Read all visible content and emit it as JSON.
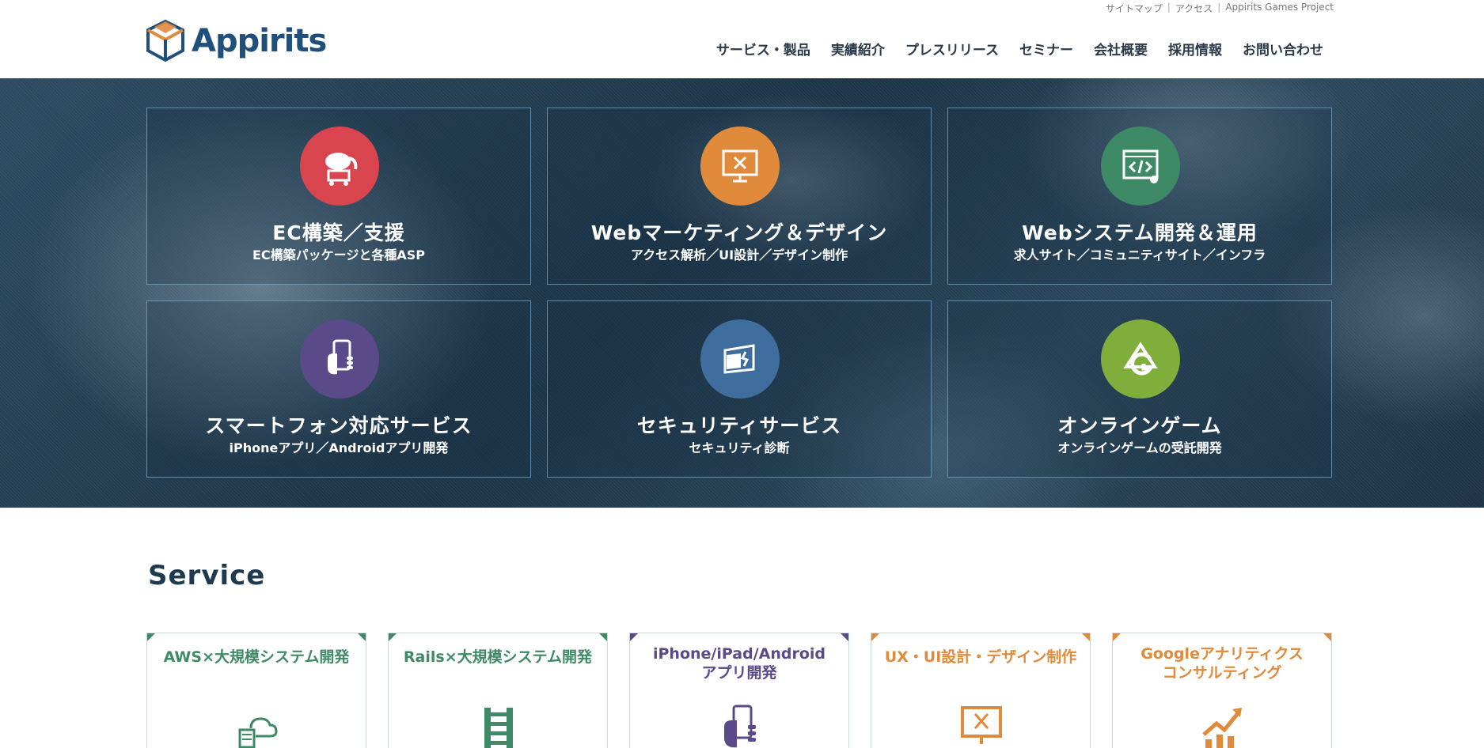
{
  "header": {
    "logo_text": "Appirits",
    "util_links": [
      "サイトマップ",
      "アクセス",
      "Appirits Games Project"
    ],
    "nav": [
      "サービス・製品",
      "実績紹介",
      "プレスリリース",
      "セミナー",
      "会社概要",
      "採用情報",
      "お問い合わせ"
    ]
  },
  "hero": {
    "tiles": [
      {
        "title": "EC構築／支援",
        "sub": "EC構築パッケージと各種ASP",
        "icon": "elephant-cart-icon",
        "color": "#d9454e"
      },
      {
        "title": "Webマーケティング＆デザイン",
        "sub": "アクセス解析／UI設計／デザイン制作",
        "icon": "monitor-design-icon",
        "color": "#e08a3c"
      },
      {
        "title": "Webシステム開発＆運用",
        "sub": "求人サイト／コミュニティサイト／インフラ",
        "icon": "code-window-icon",
        "color": "#3f8a66"
      },
      {
        "title": "スマートフォン対応サービス",
        "sub": "iPhoneアプリ／Androidアプリ開発",
        "icon": "smartphone-hand-icon",
        "color": "#5b4a8a"
      },
      {
        "title": "セキュリティサービス",
        "sub": "セキュリティ診断",
        "icon": "security-wall-icon",
        "color": "#3f6e9e"
      },
      {
        "title": "オンラインゲーム",
        "sub": "オンラインゲームの受託開発",
        "icon": "game-logo-icon",
        "color": "#7fae3a"
      }
    ]
  },
  "service": {
    "heading": "Service",
    "cards": [
      {
        "title": "AWS×大規模システム開発",
        "color": "#3f8a66",
        "icon": "cloud-server-icon"
      },
      {
        "title": "Rails×大規模システム開発",
        "color": "#3f8a66",
        "icon": "rails-icon"
      },
      {
        "title": "iPhone/iPad/Android\nアプリ開発",
        "line1": "iPhone/iPad/Android",
        "line2": "アプリ開発",
        "color": "#5b4a8a",
        "icon": "smartphone-hand-icon"
      },
      {
        "title": "UX・UI設計・デザイン制作",
        "color": "#e08a3c",
        "icon": "monitor-design-icon"
      },
      {
        "title": "Googleアナリティクス\nコンサルティング",
        "line1": "Googleアナリティクス",
        "line2": "コンサルティング",
        "color": "#e08a3c",
        "icon": "growth-chart-icon"
      }
    ]
  }
}
